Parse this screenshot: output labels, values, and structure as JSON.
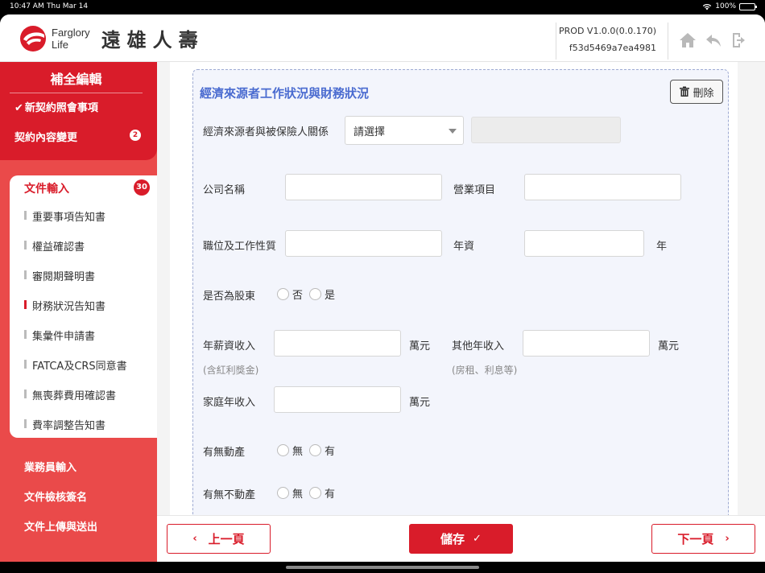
{
  "status": {
    "time": "10:47 AM",
    "date": "Thu Mar 14",
    "battery": "100%"
  },
  "header": {
    "brand_line1": "Farglory",
    "brand_line2": "Life",
    "brand_zh": "遠雄人壽",
    "version": "PROD V1.0.0(0.0.170)",
    "build": "f53d5469a7ea4981",
    "icons": [
      "home-icon",
      "back-icon",
      "logout-icon"
    ]
  },
  "sidebar": {
    "title": "補全編輯",
    "top_items": [
      {
        "label": "新契約照會事項",
        "checked": true
      },
      {
        "label": "契約內容變更",
        "badge": "2"
      }
    ],
    "doc_section": {
      "label": "文件輸入",
      "badge": "30",
      "items": [
        "重要事項告知書",
        "權益確認書",
        "審閱期聲明書",
        "財務狀況告知書",
        "集彙件申請書",
        "FATCA及CRS同意書",
        "無喪葬費用確認書",
        "費率調整告知書"
      ],
      "active_index": 3
    },
    "bottom_items": [
      "業務員輸入",
      "文件檢核簽名",
      "文件上傳與送出"
    ]
  },
  "form": {
    "section_title": "經濟來源者工作狀況與財務狀況",
    "delete_label": "刪除",
    "relation_label": "經濟來源者與被保險人關係",
    "relation_select": "請選擇",
    "company_label": "公司名稱",
    "business_label": "營業項目",
    "position_label": "職位及工作性質",
    "seniority_label": "年資",
    "seniority_unit": "年",
    "shareholder_label": "是否為股東",
    "shareholder_options": [
      "否",
      "是"
    ],
    "salary_label": "年薪資收入",
    "salary_sub": "(含紅利獎金)",
    "salary_unit": "萬元",
    "other_income_label": "其他年收入",
    "other_income_sub": "(房租、利息等)",
    "other_income_unit": "萬元",
    "family_income_label": "家庭年收入",
    "family_income_unit": "萬元",
    "movable_label": "有無動產",
    "movable_options": [
      "無",
      "有"
    ],
    "real_estate_label": "有無不動產",
    "real_estate_options": [
      "無",
      "有"
    ]
  },
  "footer": {
    "prev_label": "上一頁",
    "save_label": "儲存",
    "next_label": "下一頁"
  },
  "colors": {
    "brand_red": "#d91c2a",
    "sidebar_red": "#ea4a4a",
    "section_blue": "#4a6bd0"
  }
}
